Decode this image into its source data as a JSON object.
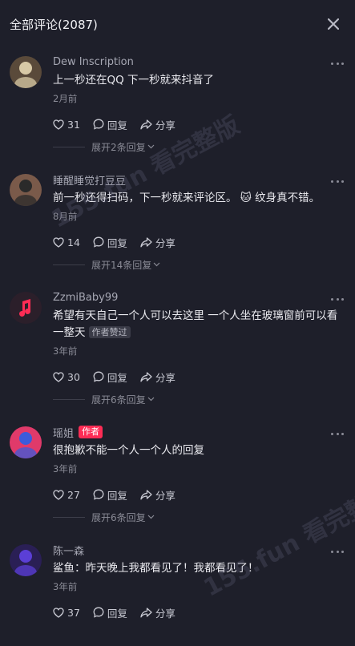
{
  "header": {
    "title": "全部评论(2087)",
    "close_icon": "close-icon"
  },
  "labels": {
    "reply": "回复",
    "share": "分享"
  },
  "comments": [
    {
      "name": "Dew Inscription",
      "badge": "",
      "text": "上一秒还在QQ 下一秒就来抖音了",
      "tag": "",
      "date": "2月前",
      "likes": "31",
      "replies": "展开2条回复",
      "avatar_colors": [
        "#d8c9a6",
        "#5a4a3a"
      ]
    },
    {
      "name": "睡醒睡觉打豆豆",
      "badge": "",
      "text": "前一秒还得扫码，下一秒就来评论区。 🐱 纹身真不错。",
      "tag": "",
      "date": "8月前",
      "likes": "14",
      "replies": "展开14条回复",
      "avatar_colors": [
        "#2a2a2a",
        "#7a5a4a"
      ]
    },
    {
      "name": "ZzmiBaby99",
      "badge": "",
      "text": "希望有天自己一个人可以去这里 一个人坐在玻璃窗前可以看一整天",
      "tag": "作者赞过",
      "date": "3年前",
      "likes": "30",
      "replies": "展开6条回复",
      "avatar_colors": [
        "#2b1f2a",
        "#fe2c55"
      ]
    },
    {
      "name": "瑶姐",
      "badge": "作者",
      "text": "很抱歉不能一个人一个人的回复",
      "tag": "",
      "date": "3年前",
      "likes": "27",
      "replies": "展开6条回复",
      "avatar_colors": [
        "#3b5bdb",
        "#e03a6a"
      ]
    },
    {
      "name": "陈一森",
      "badge": "",
      "text": "鲨鱼：昨天晚上我都看见了！我都看见了！",
      "tag": "",
      "date": "3年前",
      "likes": "37",
      "replies": "",
      "avatar_colors": [
        "#5b3fd6",
        "#2a1f55"
      ]
    }
  ],
  "watermark": "155.fun 看完整版"
}
